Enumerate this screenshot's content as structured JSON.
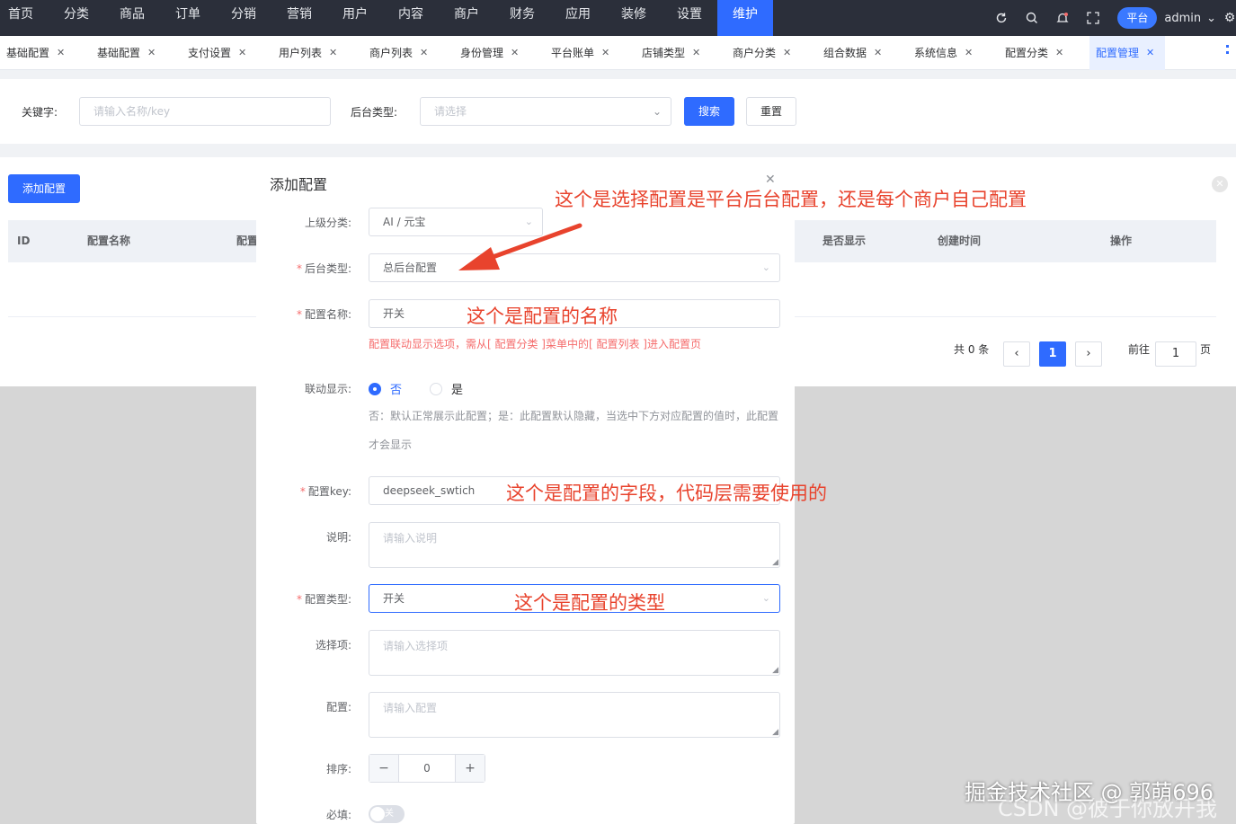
{
  "topnav": {
    "menu": [
      "首页",
      "分类",
      "商品",
      "订单",
      "分销",
      "营销",
      "用户",
      "内容",
      "商户",
      "财务",
      "应用",
      "装修",
      "设置",
      "维护"
    ],
    "active_index": 13,
    "platform_label": "平台",
    "user_label": "admin"
  },
  "tabs": [
    {
      "label": "基础配置"
    },
    {
      "label": "基础配置"
    },
    {
      "label": "支付设置"
    },
    {
      "label": "用户列表"
    },
    {
      "label": "商户列表"
    },
    {
      "label": "身份管理"
    },
    {
      "label": "平台账单"
    },
    {
      "label": "店铺类型"
    },
    {
      "label": "商户分类"
    },
    {
      "label": "组合数据"
    },
    {
      "label": "系统信息"
    },
    {
      "label": "配置分类"
    },
    {
      "label": "配置管理",
      "active": true
    }
  ],
  "filter": {
    "keyword_label": "关键字:",
    "keyword_placeholder": "请输入名称/key",
    "type_label": "后台类型:",
    "type_placeholder": "请选择",
    "search_label": "搜索",
    "reset_label": "重置"
  },
  "list": {
    "add_label": "添加配置",
    "columns": [
      "ID",
      "配置名称",
      "配置",
      "是否显示",
      "创建时间",
      "操作"
    ],
    "total_text": "共 0 条",
    "current_page": "1",
    "goto_label": "前往",
    "goto_value": "1",
    "page_suffix": "页"
  },
  "modal": {
    "title": "添加配置",
    "parent_label": "上级分类:",
    "parent_value": "AI / 元宝",
    "backend_type_label": "后台类型:",
    "backend_type_value": "总后台配置",
    "name_label": "配置名称:",
    "name_value": "开关",
    "name_helper": "配置联动显示选项，需从[ 配置分类 ]菜单中的[ 配置列表 ]进入配置页",
    "linked_label": "联动显示:",
    "linked_options": [
      "否",
      "是"
    ],
    "linked_selected": "否",
    "linked_helper": "否：默认正常展示此配置；是：此配置默认隐藏，当选中下方对应配置的值时，此配置才会显示",
    "key_label": "配置key:",
    "key_value": "deepseek_swtich",
    "desc_label": "说明:",
    "desc_placeholder": "请输入说明",
    "config_type_label": "配置类型:",
    "config_type_value": "开关",
    "options_label": "选择项:",
    "options_placeholder": "请输入选择项",
    "config_label": "配置:",
    "config_placeholder": "请输入配置",
    "sort_label": "排序:",
    "sort_value": "0",
    "required_label": "必填:",
    "required_switch_text": "关"
  },
  "annotations": {
    "backend_type": "这个是选择配置是平台后台配置，还是每个商户自己配置",
    "name": "这个是配置的名称",
    "key": "这个是配置的字段，代码层需要使用的",
    "config_type": "这个是配置的类型",
    "color": "#e8432d"
  },
  "watermark": {
    "line1": "掘金技术社区 @ 郭萌696",
    "line2": "CSDN @彼于你放开我"
  },
  "colors": {
    "primary": "#2f6bff",
    "nav_bg": "#2b2f3a",
    "danger": "#f56c6c"
  }
}
